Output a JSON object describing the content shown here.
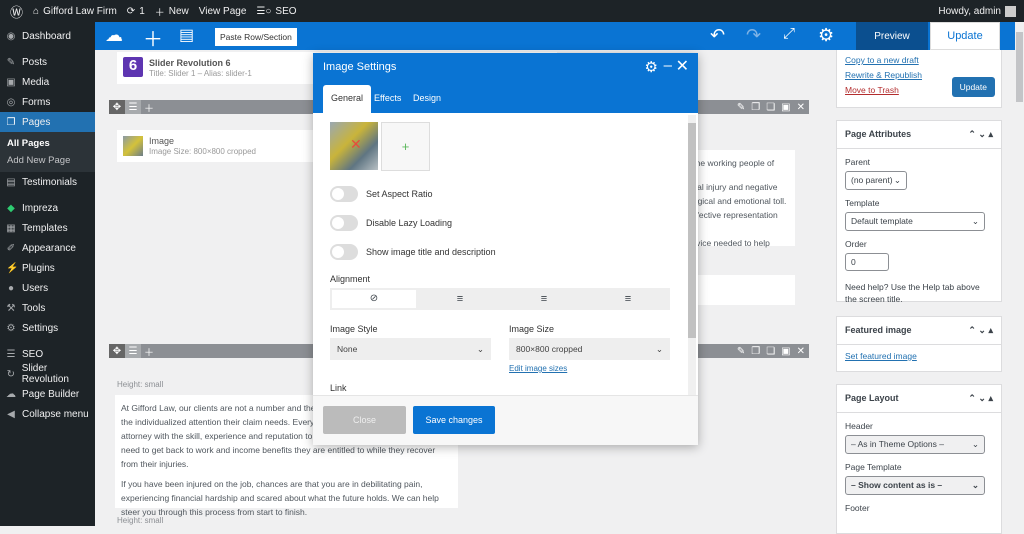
{
  "admin_bar": {
    "site": "Gifford Law Firm",
    "updates": "1",
    "new": "New",
    "view_page": "View Page",
    "seo": "SEO",
    "greeting": "Howdy, admin"
  },
  "sidebar": {
    "items": [
      {
        "label": "Dashboard",
        "icon": "dashboard-icon"
      },
      {
        "label": "Posts",
        "icon": "pin-icon"
      },
      {
        "label": "Media",
        "icon": "media-icon"
      },
      {
        "label": "Forms",
        "icon": "forms-icon"
      },
      {
        "label": "Pages",
        "icon": "pages-icon"
      },
      {
        "label": "Testimonials",
        "icon": "testimonials-icon"
      },
      {
        "label": "Impreza",
        "icon": "diamond-icon"
      },
      {
        "label": "Templates",
        "icon": "templates-icon"
      },
      {
        "label": "Appearance",
        "icon": "brush-icon"
      },
      {
        "label": "Plugins",
        "icon": "plugin-icon"
      },
      {
        "label": "Users",
        "icon": "users-icon"
      },
      {
        "label": "Tools",
        "icon": "wrench-icon"
      },
      {
        "label": "Settings",
        "icon": "settings-icon"
      },
      {
        "label": "SEO",
        "icon": "seo-icon"
      },
      {
        "label": "Slider Revolution",
        "icon": "slider-icon"
      },
      {
        "label": "Page Builder",
        "icon": "cloud-icon"
      },
      {
        "label": "Collapse menu",
        "icon": "collapse-icon"
      }
    ],
    "sub": [
      "All Pages",
      "Add New Page"
    ]
  },
  "toolbar": {
    "paste": "Paste Row/Section",
    "preview": "Preview",
    "update": "Update"
  },
  "stage": {
    "slider_title": "Slider Revolution 6",
    "slider_sub": "Title: Slider 1 – Alias: slider-1",
    "image_title": "Image",
    "image_sub": "Image Size: 800×800 cropped",
    "height_label": "Height: small",
    "para1": "At Gifford Law, our clients are not a number and the focus is on providing each client the individualized attention their claim needs. Every case is different and you need an attorney with the skill, experience and reputation to help them get the medical care they need to get back to work and income benefits they are entitled to while they recover from their injuries.",
    "para2": "If you have been injured on the job, chances are that you are in debilitating pain, experiencing financial hardship and scared about what the future holds. We can help steer you through this process from start to finish.",
    "right_text1": "sting the working people of",
    "right_text2": "physical injury and negative\nychological and emotional toll.\n and effective representation to\ngal advice needed to help them"
  },
  "publish": {
    "copy_draft": "Copy to a new draft",
    "rewrite": "Rewrite & Republish",
    "trash": "Move to Trash",
    "update": "Update"
  },
  "page_attributes": {
    "title": "Page Attributes",
    "parent_label": "Parent",
    "parent": "(no parent)",
    "template_label": "Template",
    "template": "Default template",
    "order_label": "Order",
    "order": "0",
    "help": "Need help? Use the Help tab above the screen title."
  },
  "featured": {
    "title": "Featured image",
    "link": "Set featured image"
  },
  "layout": {
    "title": "Page Layout",
    "header_label": "Header",
    "header": "– As in Theme Options –",
    "template_label": "Page Template",
    "template": "– Show content as is –",
    "footer_label": "Footer"
  },
  "modal": {
    "title": "Image Settings",
    "tabs": [
      "General",
      "Effects",
      "Design"
    ],
    "toggles": [
      {
        "label": "Set Aspect Ratio",
        "on": false
      },
      {
        "label": "Disable Lazy Loading",
        "on": false
      },
      {
        "label": "Show image title and description",
        "on": false
      }
    ],
    "alignment_label": "Alignment",
    "alignment_selected": "none",
    "image_style_label": "Image Style",
    "image_style": "None",
    "image_size_label": "Image Size",
    "image_size": "800×800 cropped",
    "edit_sizes": "Edit image sizes",
    "link_label": "Link",
    "close": "Close",
    "save": "Save changes"
  }
}
